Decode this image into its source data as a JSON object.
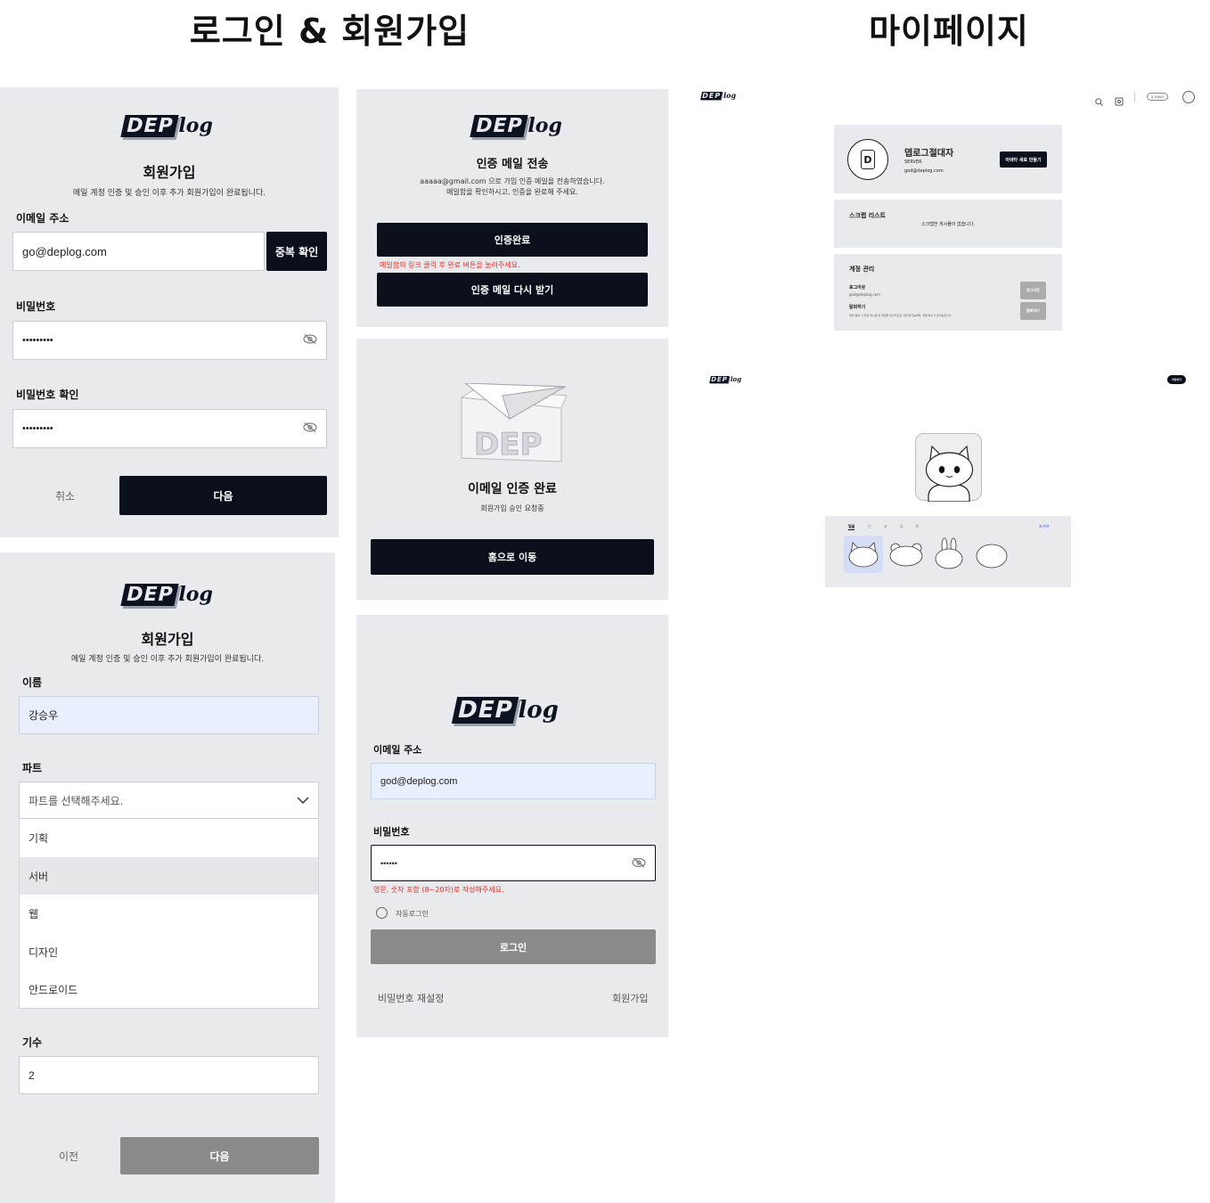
{
  "section_titles": {
    "login_signup": "로그인 & 회원가입",
    "mypage": "마이페이지"
  },
  "logo": {
    "block_text": "DEP",
    "suffix": "log"
  },
  "signup_step1": {
    "title": "회원가입",
    "subtitle": "메일 계정 인증 및 승인 이후 추가 회원가입이 완료됩니다.",
    "email_label": "이메일 주소",
    "email_value": "go@deplog.com",
    "dup_check_button": "중복 확인",
    "password_label": "비밀번호",
    "password_value": "•••••••••",
    "password_confirm_label": "비밀번호 확인",
    "password_confirm_value": "•••••••••",
    "cancel_button": "취소",
    "next_button": "다음"
  },
  "signup_step2": {
    "title": "회원가입",
    "subtitle": "메일 계정 인증 및 승인 이후 추가 회원가입이 완료됩니다.",
    "name_label": "이름",
    "name_value": "강승우",
    "part_label": "파트",
    "part_placeholder": "파트를 선택해주세요.",
    "part_options": [
      "기획",
      "서버",
      "웹",
      "디자인",
      "안드로이드"
    ],
    "selected_option_index": 1,
    "generation_label": "기수",
    "generation_value": "2",
    "prev_button": "이전",
    "next_button": "다음"
  },
  "email_sent": {
    "title": "인증 메일 전송",
    "desc_line1": "aaaaa@gmail.com 으로 가입 인증 메일을 전송하였습니다.",
    "desc_line2": "메일함을 확인하시고, 인증을 완료해 주세요.",
    "complete_button": "인증완료",
    "error_text": "메일함의 링크 클릭 후 완료 버튼을 눌러주세요.",
    "resend_button": "인증 메일 다시 받기"
  },
  "email_verified": {
    "title": "이메일 인증 완료",
    "subtitle": "회원가입 승인 요청중",
    "home_button": "홈으로 이동"
  },
  "login": {
    "email_label": "이메일 주소",
    "email_value": "god@deplog.com",
    "password_label": "비밀번호",
    "password_value": "••••••",
    "error_text": "영문, 숫자 포함 (8~20자)로 작성해주세요.",
    "auto_login_label": "자동로그인",
    "login_button": "로그인",
    "reset_password_link": "비밀번호 재설정",
    "signup_link": "회원가입"
  },
  "mypage": {
    "header_button": "글 작성하기",
    "profile": {
      "avatar_letter": "D",
      "name": "뎁로그절대자",
      "part": "SERVER",
      "email": "god@deplog.com",
      "avatar_button": "아바타 새로 만들기"
    },
    "scrap": {
      "title": "스크랩 리스트",
      "empty_text": "스크랩한 게시물이 없습니다."
    },
    "account": {
      "title": "계정 관리",
      "logout_label": "로그아웃",
      "logout_email": "god@deplog.com",
      "logout_button": "로그아웃",
      "withdraw_label": "탈퇴하기",
      "withdraw_desc": "계정 탈퇴 시 작성 게시글 및 댓글을 영구적으로 삭제 불가능하며, 계정 복구가 불가능합니다.",
      "withdraw_button": "탈퇴하기"
    }
  },
  "avatar_editor": {
    "done_button": "저장하기",
    "tabs": [
      "얼굴",
      "눈",
      "코",
      "입",
      "귀"
    ],
    "reset_link": "초기화"
  }
}
